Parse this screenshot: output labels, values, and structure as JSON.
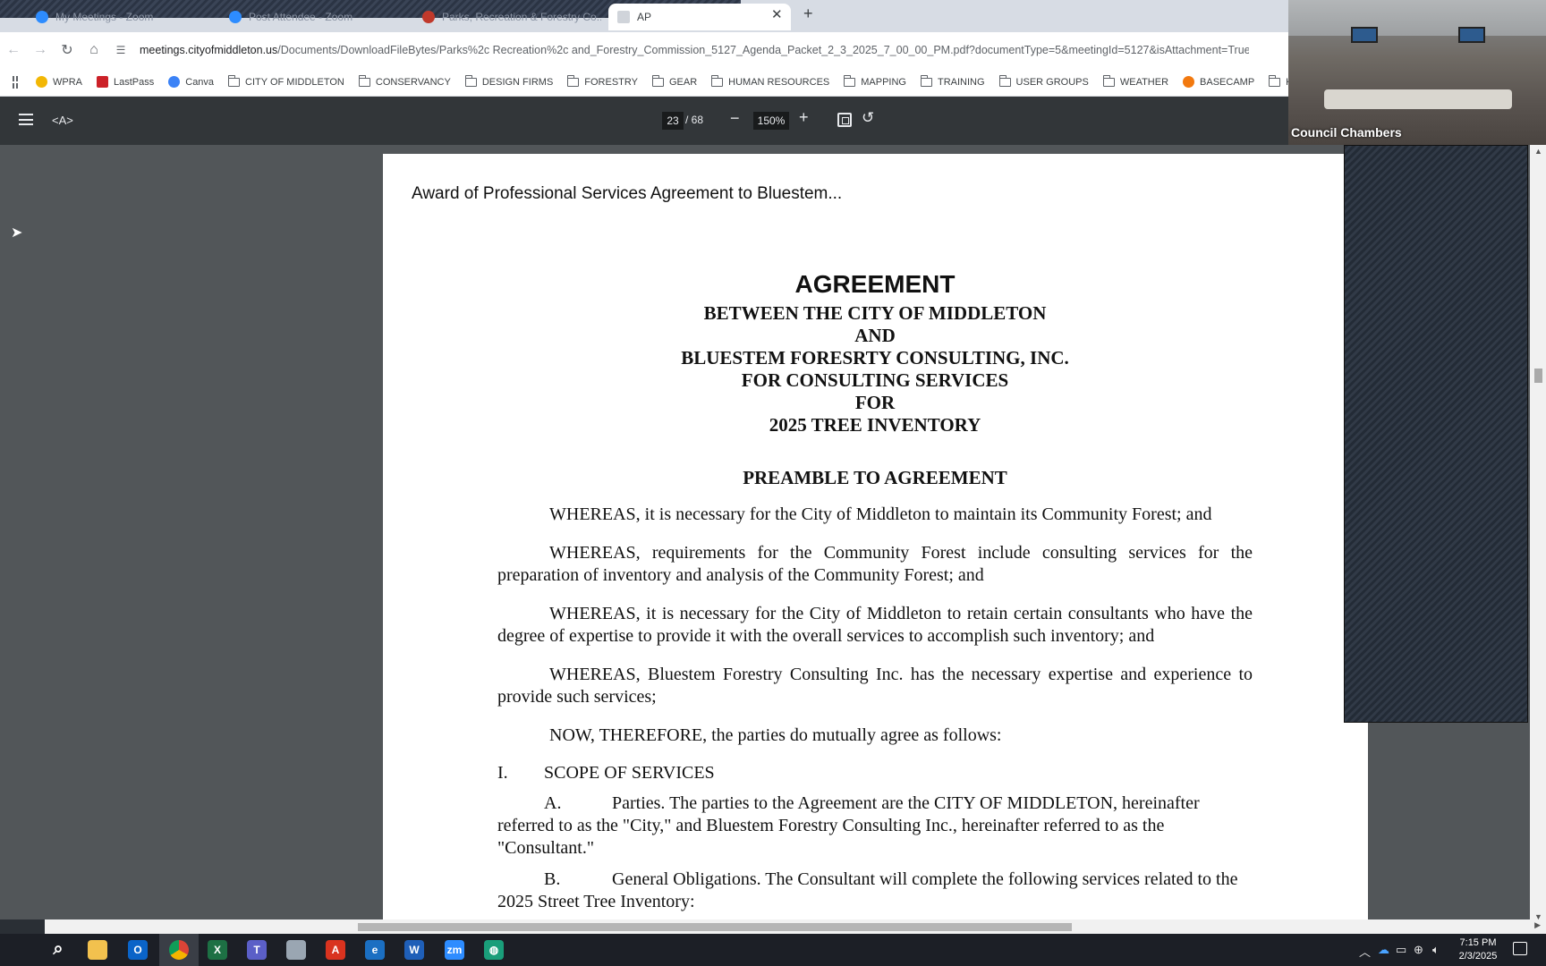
{
  "browser": {
    "tabs": [
      {
        "label": "My Meetings - Zoom",
        "color": "#2d8cff"
      },
      {
        "label": "Post Attendee - Zoom",
        "color": "#2d8cff"
      },
      {
        "label": "Parks, Recreation & Forestry Co...",
        "color": "#c0392b"
      },
      {
        "label": "AP"
      }
    ],
    "tab_close": "✕",
    "new_tab": "+",
    "url_host": "meetings.cityofmiddleton.us",
    "url_path": "/Documents/DownloadFileBytes/Parks%2c Recreation%2c and_Forestry_Commission_5127_Agenda_Packet_2_3_2025_7_00_00_PM.pdf?documentType=5&meetingId=5127&isAttachment=True",
    "bookmarks": [
      {
        "label": "WPRA",
        "type": "dot",
        "color": "#f2b705"
      },
      {
        "label": "LastPass",
        "type": "sq",
        "color": "#cc2128"
      },
      {
        "label": "Canva",
        "type": "dot",
        "color": "#3b82f6"
      },
      {
        "label": "CITY OF MIDDLETON",
        "type": "folder"
      },
      {
        "label": "CONSERVANCY",
        "type": "folder"
      },
      {
        "label": "DESIGN FIRMS",
        "type": "folder"
      },
      {
        "label": "FORESTRY",
        "type": "folder"
      },
      {
        "label": "GEAR",
        "type": "folder"
      },
      {
        "label": "HUMAN RESOURCES",
        "type": "folder"
      },
      {
        "label": "MAPPING",
        "type": "folder"
      },
      {
        "label": "TRAINING",
        "type": "folder"
      },
      {
        "label": "USER GROUPS",
        "type": "folder"
      },
      {
        "label": "WEATHER",
        "type": "folder"
      },
      {
        "label": "BASECAMP",
        "type": "dot",
        "color": "#f2790f"
      },
      {
        "label": "KEVIN",
        "type": "folder"
      }
    ]
  },
  "pdf_toolbar": {
    "doc_name": "<A>",
    "page_current": "23",
    "page_total": "/ 68",
    "zoom": "150%",
    "minus": "−",
    "plus": "+"
  },
  "document": {
    "header": "Award of Professional Services Agreement to Bluestem...",
    "title": "AGREEMENT",
    "title_lines": [
      "BETWEEN THE CITY OF MIDDLETON",
      "AND",
      "BLUESTEM FORESRTY CONSULTING, INC.",
      "FOR CONSULTING SERVICES",
      "FOR",
      "2025 TREE INVENTORY"
    ],
    "preamble_heading": "PREAMBLE TO AGREEMENT",
    "paragraphs": [
      "WHEREAS, it is necessary for the City of Middleton to maintain its Community Forest; and",
      "WHEREAS, requirements for the Community Forest include consulting services for the preparation of inventory and analysis of the Community Forest; and",
      "WHEREAS, it is necessary for the City of Middleton to retain certain consultants who have the degree of expertise to provide it with the overall services to accomplish such inventory; and",
      "WHEREAS, Bluestem Forestry Consulting Inc. has the necessary expertise and experience to provide such services;",
      "NOW, THEREFORE, the parties do mutually agree as follows:"
    ],
    "section_number": "I.",
    "section_title": "SCOPE OF SERVICES",
    "subsections": [
      {
        "letter": "A.",
        "text": "Parties.  The parties to the Agreement are the CITY OF MIDDLETON, hereinafter referred to as the \"City,\" and Bluestem Forestry Consulting Inc., hereinafter referred to as the \"Consultant.\""
      },
      {
        "letter": "B.",
        "text": "General Obligations.  The Consultant will complete the following services related to the 2025 Street Tree Inventory:"
      }
    ]
  },
  "video": {
    "label": "Council Chambers"
  },
  "taskbar": {
    "apps": [
      {
        "name": "search-icon",
        "glyph": "⌕",
        "color": "transparent"
      },
      {
        "name": "file-explorer-icon",
        "glyph": "",
        "color": "#f2c14e"
      },
      {
        "name": "outlook-icon",
        "glyph": "O",
        "color": "#0a64c8"
      },
      {
        "name": "chrome-icon",
        "glyph": "",
        "color": "#db4437"
      },
      {
        "name": "excel-icon",
        "glyph": "X",
        "color": "#1d7044"
      },
      {
        "name": "teams-icon",
        "glyph": "T",
        "color": "#5b5fc7"
      },
      {
        "name": "notepad-icon",
        "glyph": "",
        "color": "#9aa6b2"
      },
      {
        "name": "acrobat-icon",
        "glyph": "A",
        "color": "#d9331f"
      },
      {
        "name": "edge-icon",
        "glyph": "e",
        "color": "#1b6fc2"
      },
      {
        "name": "word-icon",
        "glyph": "W",
        "color": "#1f5fb8"
      },
      {
        "name": "zoom-icon",
        "glyph": "zm",
        "color": "#2d8cff"
      },
      {
        "name": "globe-app-icon",
        "glyph": "◍",
        "color": "#1a9e7a"
      }
    ],
    "time": "7:15 PM",
    "date": "2/3/2025"
  }
}
